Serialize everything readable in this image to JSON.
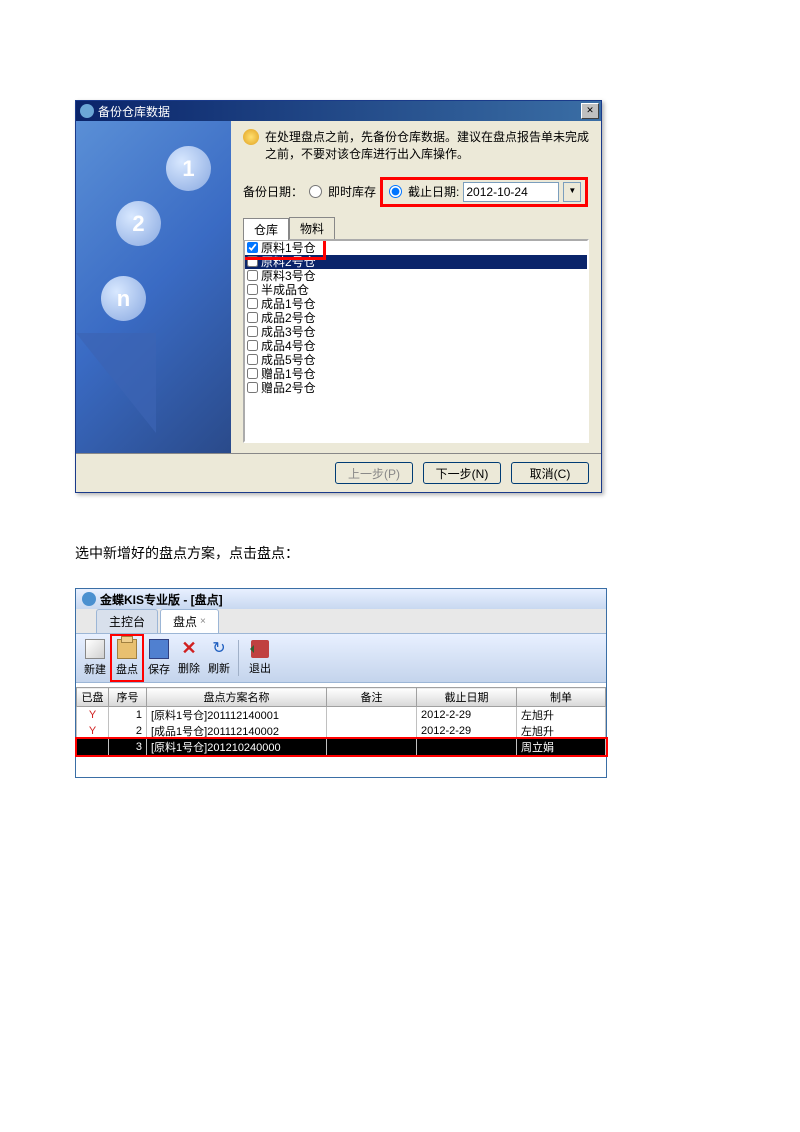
{
  "dialog1": {
    "title": "备份仓库数据",
    "hint": "在处理盘点之前，先备份仓库数据。建议在盘点报告单未完成之前，不要对该仓库进行出入库操作。",
    "backup_label": "备份日期：",
    "radio_instant": "即时库存",
    "radio_cutoff": "截止日期:",
    "cutoff_date": "2012-10-24",
    "tab_warehouse": "仓库",
    "tab_material": "物料",
    "warehouses": [
      {
        "name": "原料1号仓",
        "checked": true,
        "selected": false
      },
      {
        "name": "原料2号仓",
        "checked": false,
        "selected": true
      },
      {
        "name": "原料3号仓",
        "checked": false,
        "selected": false
      },
      {
        "name": "半成品仓",
        "checked": false,
        "selected": false
      },
      {
        "name": "成品1号仓",
        "checked": false,
        "selected": false
      },
      {
        "name": "成品2号仓",
        "checked": false,
        "selected": false
      },
      {
        "name": "成品3号仓",
        "checked": false,
        "selected": false
      },
      {
        "name": "成品4号仓",
        "checked": false,
        "selected": false
      },
      {
        "name": "成品5号仓",
        "checked": false,
        "selected": false
      },
      {
        "name": "赠品1号仓",
        "checked": false,
        "selected": false
      },
      {
        "name": "赠品2号仓",
        "checked": false,
        "selected": false
      }
    ],
    "btn_prev": "上一步(P)",
    "btn_next": "下一步(N)",
    "btn_cancel": "取消(C)"
  },
  "instruction": "选中新增好的盘点方案，点击盘点：",
  "window2": {
    "title": "金蝶KIS专业版 - [盘点]",
    "tabs": {
      "main": "主控台",
      "count": "盘点"
    },
    "toolbar": {
      "new": "新建",
      "count": "盘点",
      "save": "保存",
      "delete": "删除",
      "refresh": "刷新",
      "exit": "退出"
    },
    "columns": {
      "done": "已盘",
      "seq": "序号",
      "plan": "盘点方案名称",
      "remark": "备注",
      "cutoff": "截止日期",
      "maker": "制单"
    },
    "rows": [
      {
        "done": "Y",
        "seq": "1",
        "plan": "[原料1号仓]201112140001",
        "remark": "",
        "cutoff": "2012-2-29",
        "maker": "左旭升",
        "selected": false
      },
      {
        "done": "Y",
        "seq": "2",
        "plan": "[成品1号仓]201112140002",
        "remark": "",
        "cutoff": "2012-2-29",
        "maker": "左旭升",
        "selected": false
      },
      {
        "done": "",
        "seq": "3",
        "plan": "[原料1号仓]201210240000",
        "remark": "",
        "cutoff": "",
        "maker": "周立娟",
        "selected": true
      }
    ]
  }
}
